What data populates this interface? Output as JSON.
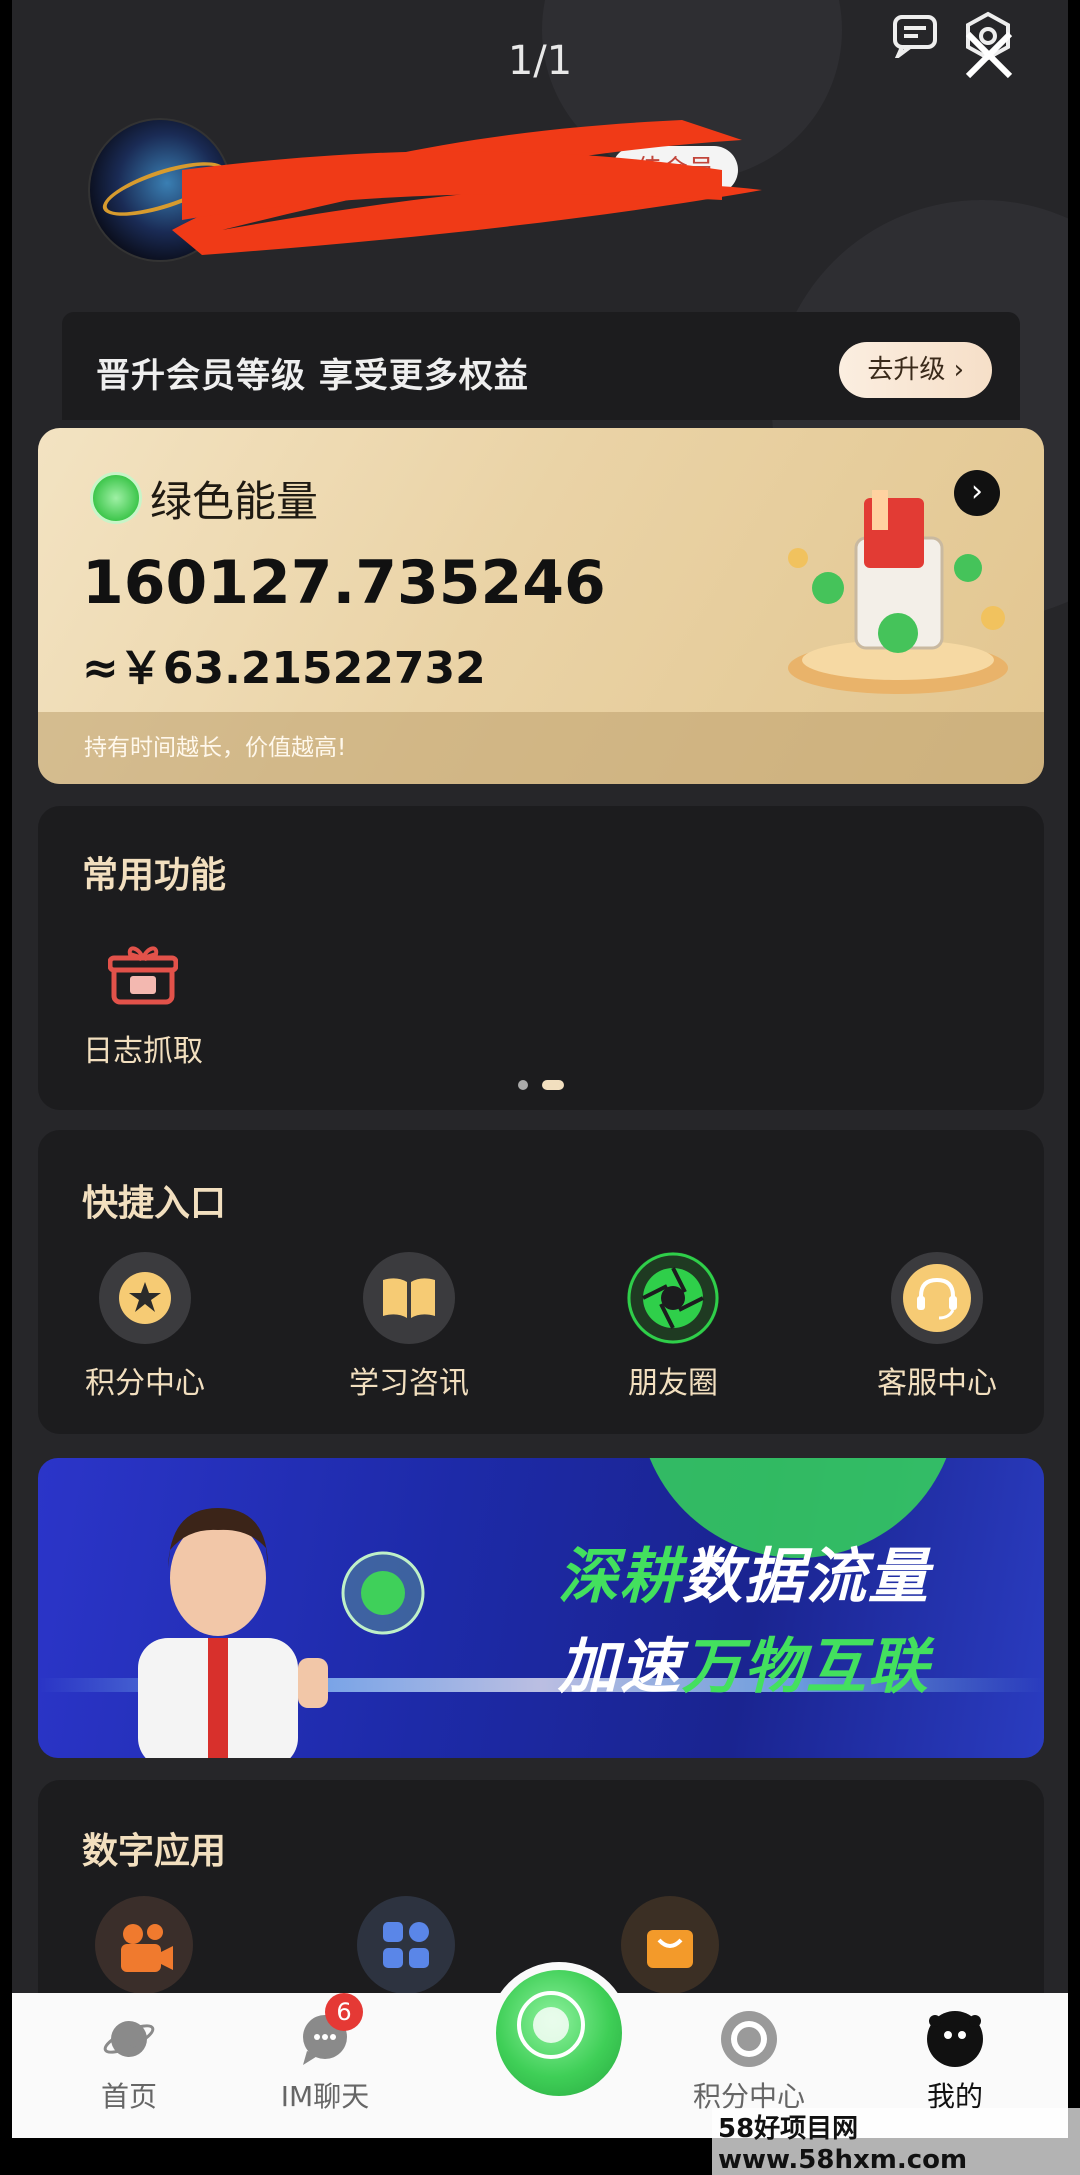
{
  "viewer": {
    "page_indicator": "1/1"
  },
  "profile": {
    "member_badge": "佳会员"
  },
  "upgrade_banner": {
    "text": "晋升会员等级   享受更多权益",
    "button": "去升级 ›"
  },
  "energy_card": {
    "title": "绿色能量",
    "amount": "160127.735246",
    "rmb_value": "≈￥63.21522732",
    "hint": "持有时间越长，价值越高!"
  },
  "common_functions": {
    "title": "常用功能",
    "items": [
      {
        "label": "日志抓取",
        "icon": "gift-icon"
      }
    ],
    "page_dots": 2,
    "active_dot": 1
  },
  "quick_entry": {
    "title": "快捷入口",
    "items": [
      {
        "label": "积分中心",
        "icon": "star-icon"
      },
      {
        "label": "学习咨讯",
        "icon": "book-icon"
      },
      {
        "label": "朋友圈",
        "icon": "aperture-icon"
      },
      {
        "label": "客服中心",
        "icon": "headset-icon"
      }
    ]
  },
  "promo_banner": {
    "line1_green": "深耕",
    "line1_white": "数据流量",
    "line2_white": "加速",
    "line2_green": "万物互联"
  },
  "digital_apps": {
    "title": "数字应用",
    "items": [
      {
        "icon": "video-camera-icon"
      },
      {
        "icon": "apps-grid-icon"
      },
      {
        "icon": "shopping-bag-icon"
      }
    ]
  },
  "tabbar": {
    "items": [
      {
        "label": "首页",
        "icon": "planet-icon"
      },
      {
        "label": "IM聊天",
        "icon": "chat-icon",
        "badge": "6"
      },
      {
        "label": "积分中心",
        "icon": "points-icon"
      },
      {
        "label": "我的",
        "icon": "profile-icon"
      }
    ]
  },
  "watermark": "58好项目网www.58hxm.com",
  "colors": {
    "accent_gold": "#f2dfbf",
    "green": "#43e05e",
    "badge_red": "#e53935"
  }
}
